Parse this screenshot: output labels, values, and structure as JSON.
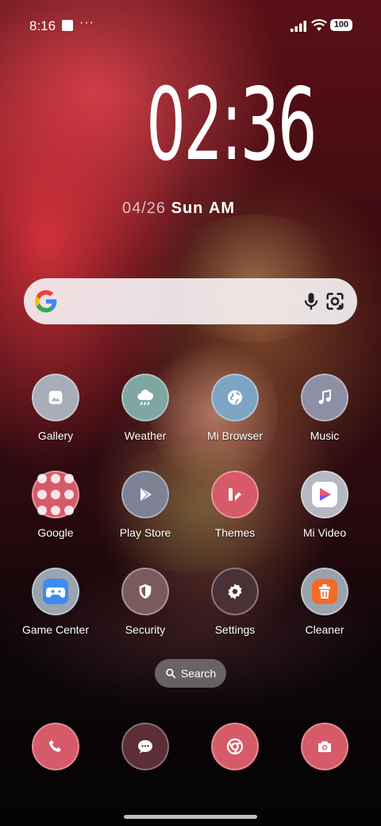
{
  "status_bar": {
    "time": "8:16",
    "more": "···",
    "battery": "100"
  },
  "clock": {
    "time": "02:36",
    "date": "04/26",
    "weekday": "Sun",
    "ampm": "AM"
  },
  "search_widget": {
    "logo": "google-logo",
    "mic": "mic-icon",
    "lens": "lens-icon"
  },
  "apps": [
    {
      "label": "Gallery",
      "icon": "gallery-icon",
      "color": "#a9adb7"
    },
    {
      "label": "Weather",
      "icon": "cloud-rain-icon",
      "color": "#7fa6a2"
    },
    {
      "label": "Mi Browser",
      "icon": "globe-icon",
      "color": "#7ba5c2"
    },
    {
      "label": "Music",
      "icon": "music-note-icon",
      "color": "#8e8fa5"
    },
    {
      "label": "Google",
      "icon": "folder-icon",
      "color": "#d75a68"
    },
    {
      "label": "Play Store",
      "icon": "play-icon",
      "color": "#7c8294"
    },
    {
      "label": "Themes",
      "icon": "themes-icon",
      "color": "#d75a68"
    },
    {
      "label": "Mi Video",
      "icon": "mi-video-icon",
      "color": "#b5b8c2"
    },
    {
      "label": "Game Center",
      "icon": "gamepad-icon",
      "color": "#9aa3b0"
    },
    {
      "label": "Security",
      "icon": "shield-icon",
      "color": "#7a5a5a"
    },
    {
      "label": "Settings",
      "icon": "gear-icon",
      "color": "#4a3136"
    },
    {
      "label": "Cleaner",
      "icon": "trash-icon",
      "color": "#9aa3ab"
    }
  ],
  "search_button": {
    "label": "Search"
  },
  "dock": [
    {
      "name": "phone",
      "icon": "phone-icon",
      "color": "#d75a68"
    },
    {
      "name": "messages",
      "icon": "chat-icon",
      "color": "#5b2f35"
    },
    {
      "name": "chrome",
      "icon": "chrome-icon",
      "color": "#d75a68"
    },
    {
      "name": "camera",
      "icon": "camera-icon",
      "color": "#d75a68"
    }
  ]
}
